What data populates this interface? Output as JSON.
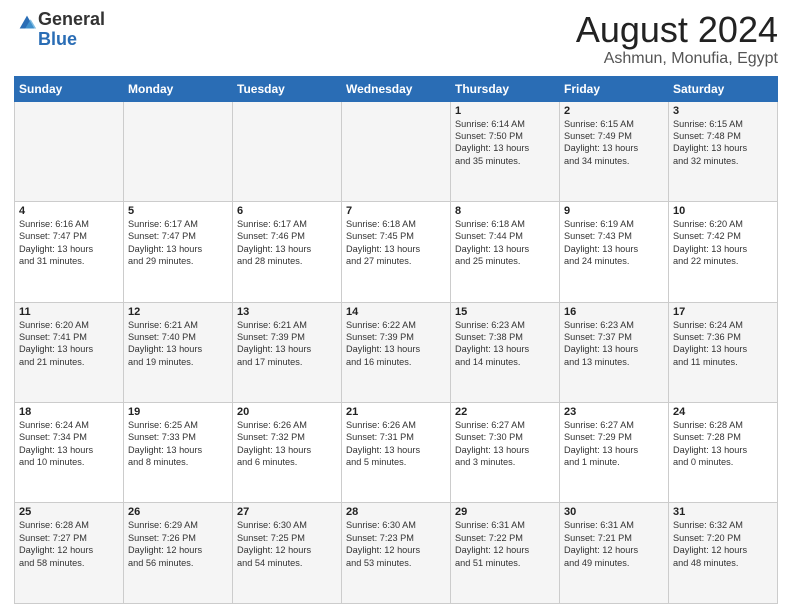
{
  "logo": {
    "general": "General",
    "blue": "Blue"
  },
  "header": {
    "month": "August 2024",
    "location": "Ashmun, Monufia, Egypt"
  },
  "weekdays": [
    "Sunday",
    "Monday",
    "Tuesday",
    "Wednesday",
    "Thursday",
    "Friday",
    "Saturday"
  ],
  "weeks": [
    [
      {
        "day": "",
        "info": ""
      },
      {
        "day": "",
        "info": ""
      },
      {
        "day": "",
        "info": ""
      },
      {
        "day": "",
        "info": ""
      },
      {
        "day": "1",
        "info": "Sunrise: 6:14 AM\nSunset: 7:50 PM\nDaylight: 13 hours\nand 35 minutes."
      },
      {
        "day": "2",
        "info": "Sunrise: 6:15 AM\nSunset: 7:49 PM\nDaylight: 13 hours\nand 34 minutes."
      },
      {
        "day": "3",
        "info": "Sunrise: 6:15 AM\nSunset: 7:48 PM\nDaylight: 13 hours\nand 32 minutes."
      }
    ],
    [
      {
        "day": "4",
        "info": "Sunrise: 6:16 AM\nSunset: 7:47 PM\nDaylight: 13 hours\nand 31 minutes."
      },
      {
        "day": "5",
        "info": "Sunrise: 6:17 AM\nSunset: 7:47 PM\nDaylight: 13 hours\nand 29 minutes."
      },
      {
        "day": "6",
        "info": "Sunrise: 6:17 AM\nSunset: 7:46 PM\nDaylight: 13 hours\nand 28 minutes."
      },
      {
        "day": "7",
        "info": "Sunrise: 6:18 AM\nSunset: 7:45 PM\nDaylight: 13 hours\nand 27 minutes."
      },
      {
        "day": "8",
        "info": "Sunrise: 6:18 AM\nSunset: 7:44 PM\nDaylight: 13 hours\nand 25 minutes."
      },
      {
        "day": "9",
        "info": "Sunrise: 6:19 AM\nSunset: 7:43 PM\nDaylight: 13 hours\nand 24 minutes."
      },
      {
        "day": "10",
        "info": "Sunrise: 6:20 AM\nSunset: 7:42 PM\nDaylight: 13 hours\nand 22 minutes."
      }
    ],
    [
      {
        "day": "11",
        "info": "Sunrise: 6:20 AM\nSunset: 7:41 PM\nDaylight: 13 hours\nand 21 minutes."
      },
      {
        "day": "12",
        "info": "Sunrise: 6:21 AM\nSunset: 7:40 PM\nDaylight: 13 hours\nand 19 minutes."
      },
      {
        "day": "13",
        "info": "Sunrise: 6:21 AM\nSunset: 7:39 PM\nDaylight: 13 hours\nand 17 minutes."
      },
      {
        "day": "14",
        "info": "Sunrise: 6:22 AM\nSunset: 7:39 PM\nDaylight: 13 hours\nand 16 minutes."
      },
      {
        "day": "15",
        "info": "Sunrise: 6:23 AM\nSunset: 7:38 PM\nDaylight: 13 hours\nand 14 minutes."
      },
      {
        "day": "16",
        "info": "Sunrise: 6:23 AM\nSunset: 7:37 PM\nDaylight: 13 hours\nand 13 minutes."
      },
      {
        "day": "17",
        "info": "Sunrise: 6:24 AM\nSunset: 7:36 PM\nDaylight: 13 hours\nand 11 minutes."
      }
    ],
    [
      {
        "day": "18",
        "info": "Sunrise: 6:24 AM\nSunset: 7:34 PM\nDaylight: 13 hours\nand 10 minutes."
      },
      {
        "day": "19",
        "info": "Sunrise: 6:25 AM\nSunset: 7:33 PM\nDaylight: 13 hours\nand 8 minutes."
      },
      {
        "day": "20",
        "info": "Sunrise: 6:26 AM\nSunset: 7:32 PM\nDaylight: 13 hours\nand 6 minutes."
      },
      {
        "day": "21",
        "info": "Sunrise: 6:26 AM\nSunset: 7:31 PM\nDaylight: 13 hours\nand 5 minutes."
      },
      {
        "day": "22",
        "info": "Sunrise: 6:27 AM\nSunset: 7:30 PM\nDaylight: 13 hours\nand 3 minutes."
      },
      {
        "day": "23",
        "info": "Sunrise: 6:27 AM\nSunset: 7:29 PM\nDaylight: 13 hours\nand 1 minute."
      },
      {
        "day": "24",
        "info": "Sunrise: 6:28 AM\nSunset: 7:28 PM\nDaylight: 13 hours\nand 0 minutes."
      }
    ],
    [
      {
        "day": "25",
        "info": "Sunrise: 6:28 AM\nSunset: 7:27 PM\nDaylight: 12 hours\nand 58 minutes."
      },
      {
        "day": "26",
        "info": "Sunrise: 6:29 AM\nSunset: 7:26 PM\nDaylight: 12 hours\nand 56 minutes."
      },
      {
        "day": "27",
        "info": "Sunrise: 6:30 AM\nSunset: 7:25 PM\nDaylight: 12 hours\nand 54 minutes."
      },
      {
        "day": "28",
        "info": "Sunrise: 6:30 AM\nSunset: 7:23 PM\nDaylight: 12 hours\nand 53 minutes."
      },
      {
        "day": "29",
        "info": "Sunrise: 6:31 AM\nSunset: 7:22 PM\nDaylight: 12 hours\nand 51 minutes."
      },
      {
        "day": "30",
        "info": "Sunrise: 6:31 AM\nSunset: 7:21 PM\nDaylight: 12 hours\nand 49 minutes."
      },
      {
        "day": "31",
        "info": "Sunrise: 6:32 AM\nSunset: 7:20 PM\nDaylight: 12 hours\nand 48 minutes."
      }
    ]
  ]
}
